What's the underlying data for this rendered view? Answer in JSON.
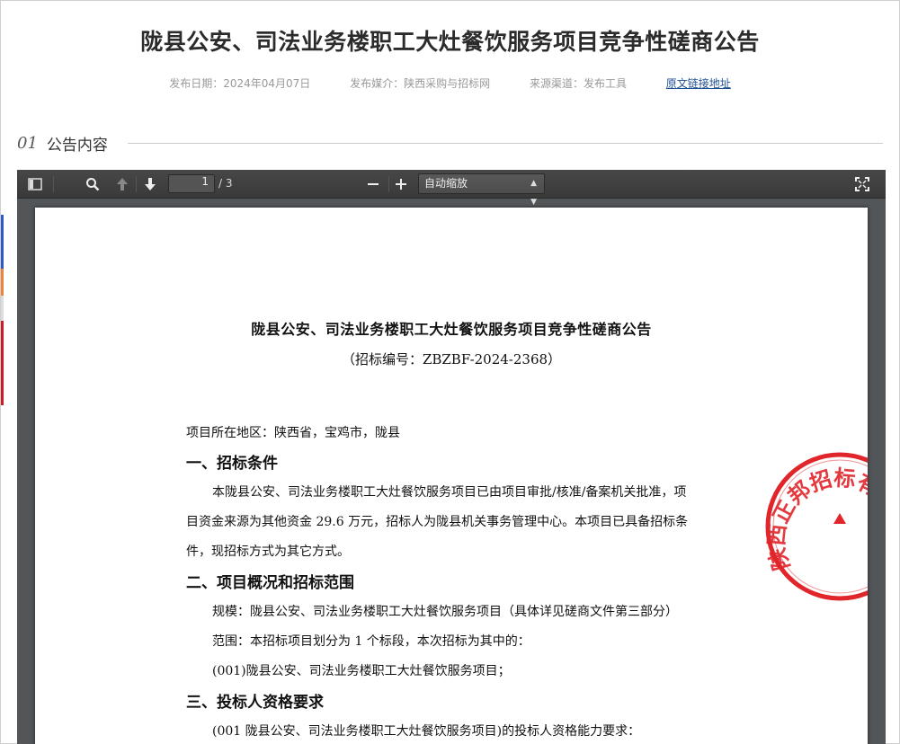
{
  "header": {
    "title": "陇县公安、司法业务楼职工大灶餐饮服务项目竞争性磋商公告",
    "publish_date": "发布日期：2024年04月07日",
    "media": "发布媒介：陕西采购与招标网",
    "source": "来源渠道：发布工具",
    "original_link": "原文链接地址"
  },
  "section": {
    "number": "01",
    "label": "公告内容"
  },
  "viewer": {
    "page_current": "1",
    "page_total": "/ 3",
    "zoom": "自动缩放",
    "icons": [
      "sidebar-toggle-icon",
      "search-icon",
      "arrow-up-icon",
      "arrow-down-icon",
      "minus-icon",
      "plus-icon",
      "fullscreen-icon"
    ]
  },
  "document": {
    "title": "陇县公安、司法业务楼职工大灶餐饮服务项目竞争性磋商公告",
    "code": "（招标编号：ZBZBF-2024-2368）",
    "region": "项目所在地区：陕西省，宝鸡市，陇县",
    "h1": "一、招标条件",
    "p1_l1": "本陇县公安、司法业务楼职工大灶餐饮服务项目已由项目审批/核准/备案机关批准，项",
    "p1_l2": "目资金来源为其他资金 29.6 万元，招标人为陇县机关事务管理中心。本项目已具备招标条",
    "p1_l3": "件，现招标方式为其它方式。",
    "h2": "二、项目概况和招标范围",
    "p2_l1": "规模：陇县公安、司法业务楼职工大灶餐饮服务项目（具体详见磋商文件第三部分）",
    "p2_l2": "范围：本招标项目划分为 1 个标段，本次招标为其中的：",
    "p2_l3": "(001)陇县公安、司法业务楼职工大灶餐饮服务项目；",
    "h3": "三、投标人资格要求",
    "p3_l1": "(001 陇县公安、司法业务楼职工大灶餐饮服务项目)的投标人资格能力要求：",
    "seal_text": "陕西正邦招标有"
  },
  "colors": {
    "link": "#1d4f91",
    "toolbar": "#3f3f3f",
    "viewer_bg": "#525659",
    "seal": "#e0252b"
  }
}
